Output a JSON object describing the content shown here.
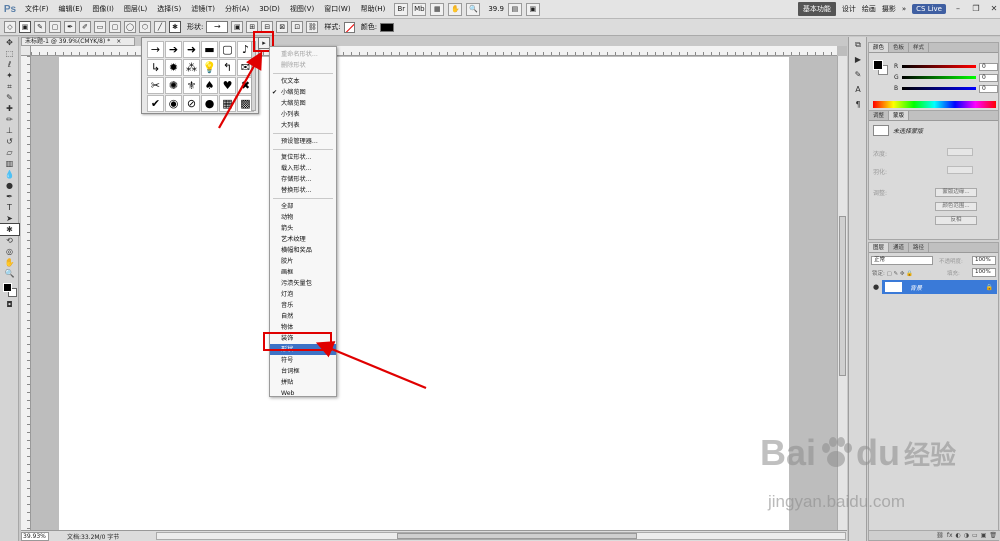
{
  "app": {
    "logo": "Ps"
  },
  "menubar": {
    "items": [
      "文件(F)",
      "编辑(E)",
      "图像(I)",
      "图层(L)",
      "选择(S)",
      "滤镜(T)",
      "分析(A)",
      "3D(D)",
      "视图(V)",
      "窗口(W)",
      "帮助(H)"
    ],
    "zoom": "39.9"
  },
  "workspace": {
    "basic": "基本功能",
    "items": [
      "设计",
      "绘画",
      "摄影"
    ],
    "more": "»",
    "cs_live": "CS Live",
    "win_minimize": "–",
    "win_restore": "❐",
    "win_close": "✕"
  },
  "options": {
    "shape_label": "形状:",
    "style_label": "样式:",
    "color_label": "颜色:",
    "shape_value": "→",
    "color_value": "#000000"
  },
  "document": {
    "tab_title": "未标题-1 @ 39.9%(CMYK/8) *",
    "tab_close": "×",
    "status_zoom": "39.93%",
    "status_doc": "文档:33.2M/0 字节"
  },
  "shape_popup": {
    "shapes": [
      "→",
      "➔",
      "➜",
      "▬",
      "▢",
      "♪",
      "↳",
      "✹",
      "⁂",
      "💡",
      "↰",
      "✉",
      "✂",
      "✺",
      "⚜",
      "♠",
      "♥",
      "✖",
      "✔",
      "◉",
      "⊘",
      "●",
      "▦",
      "▩"
    ],
    "menu_button": "▸"
  },
  "context_menu": {
    "groups": [
      [
        {
          "label": "重命名形状...",
          "disabled": true
        },
        {
          "label": "删除形状",
          "disabled": true
        }
      ],
      [
        {
          "label": "仅文本"
        },
        {
          "label": "小缩览图",
          "checked": true
        },
        {
          "label": "大缩览图"
        },
        {
          "label": "小列表"
        },
        {
          "label": "大列表"
        }
      ],
      [
        {
          "label": "预设管理器..."
        }
      ],
      [
        {
          "label": "复位形状..."
        },
        {
          "label": "载入形状..."
        },
        {
          "label": "存储形状..."
        },
        {
          "label": "替换形状..."
        }
      ],
      [
        {
          "label": "全部"
        },
        {
          "label": "动物"
        },
        {
          "label": "箭头"
        },
        {
          "label": "艺术纹理"
        },
        {
          "label": "横幅和奖品"
        },
        {
          "label": "胶片"
        },
        {
          "label": "画框"
        },
        {
          "label": "污渍矢量包"
        },
        {
          "label": "灯泡"
        },
        {
          "label": "音乐"
        },
        {
          "label": "自然"
        },
        {
          "label": "物体"
        },
        {
          "label": "装饰"
        },
        {
          "label": "形状",
          "highlighted": true
        },
        {
          "label": "符号"
        },
        {
          "label": "台词框"
        },
        {
          "label": "拼贴"
        },
        {
          "label": "Web"
        }
      ]
    ]
  },
  "right_panels": {
    "color_panel": {
      "tabs": [
        "颜色",
        "色板",
        "样式"
      ],
      "sliders": [
        {
          "letter": "R",
          "value": "0",
          "gradient": "linear-gradient(to right,#000,#f00)"
        },
        {
          "letter": "G",
          "value": "0",
          "gradient": "linear-gradient(to right,#000,#0f0)"
        },
        {
          "letter": "B",
          "value": "0",
          "gradient": "linear-gradient(to right,#000,#00f)"
        }
      ]
    },
    "masks_panel": {
      "tabs": [
        "调整",
        "蒙版"
      ],
      "label": "未选择蒙版",
      "rows": [
        "浓度:",
        "羽化:",
        "调整:"
      ],
      "buttons": [
        "蒙版边缘...",
        "颜色范围...",
        "反相"
      ]
    },
    "layers_panel": {
      "tabs": [
        "图层",
        "通道",
        "路径"
      ],
      "blend_mode": "正常",
      "opacity_label": "不透明度:",
      "opacity": "100%",
      "lock_label": "锁定: ▢ ✎ ✥ 🔒",
      "fill_label": "填充:",
      "fill": "100%",
      "layer_name": "背景",
      "layer_lock": "🔒",
      "eye": "●",
      "footer_icons": [
        "⛓",
        "fx",
        "◐",
        "◑",
        "▭",
        "▣",
        "🗑"
      ]
    }
  },
  "watermark": {
    "bai": "Bai",
    "du": "du",
    "jingyan": "经验",
    "url": "jingyan.baidu.com"
  }
}
